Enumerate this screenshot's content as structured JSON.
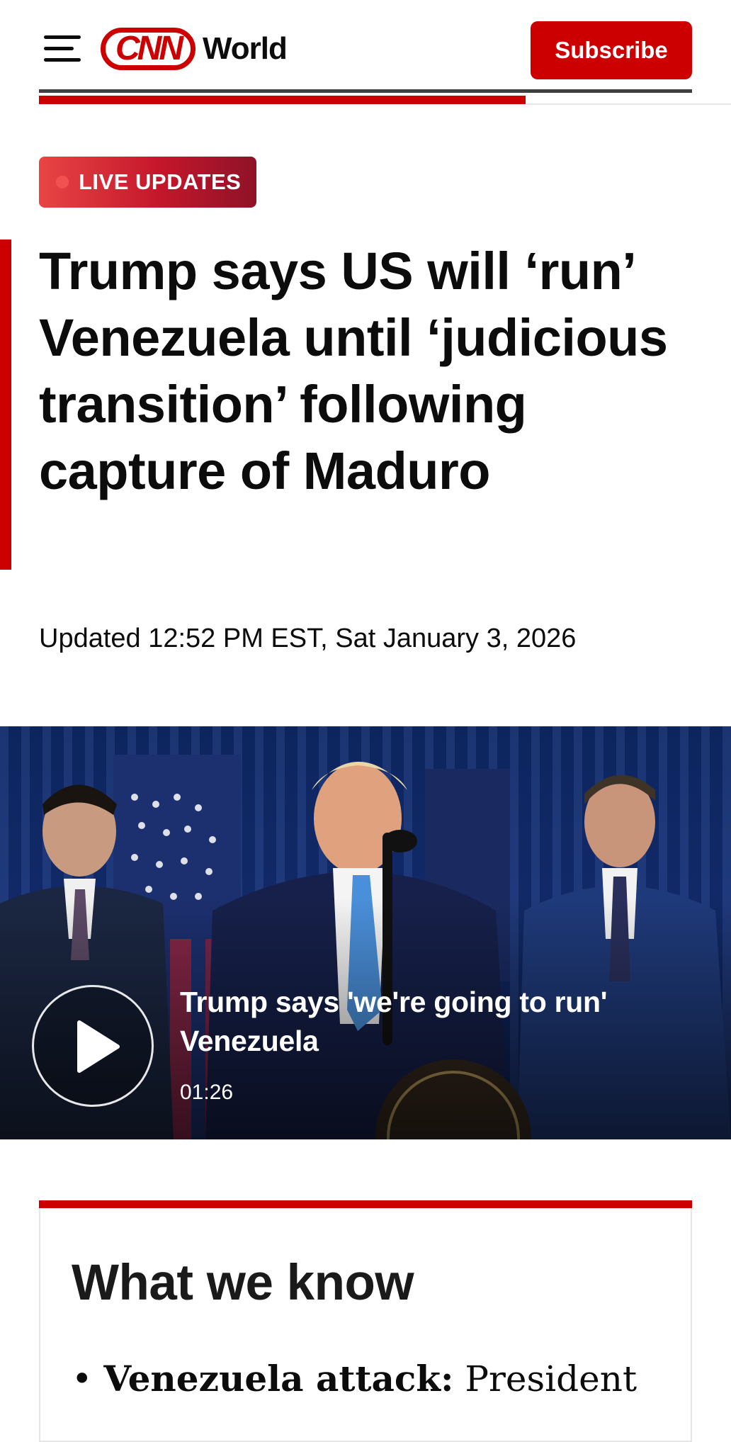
{
  "header": {
    "logo_text": "CNN",
    "section": "World",
    "subscribe_label": "Subscribe",
    "read_progress": 0.745
  },
  "article": {
    "badge": "LIVE UPDATES",
    "headline": "Trump says US will ‘run’ Venezuela until ‘judicious transition’ following capture of Maduro",
    "timestamp": "Updated 12:52 PM EST, Sat January 3, 2026"
  },
  "video": {
    "title": "Trump says 'we're going to run' Venezuela",
    "duration": "01:26"
  },
  "what_we_know": {
    "title": "What we know",
    "items": [
      {
        "bullet": "•",
        "lead": "Venezuela attack:",
        "text": "President"
      }
    ]
  },
  "colors": {
    "brand_red": "#cc0000",
    "badge_gradient_start": "#e84545",
    "badge_gradient_end": "#8f1228"
  }
}
